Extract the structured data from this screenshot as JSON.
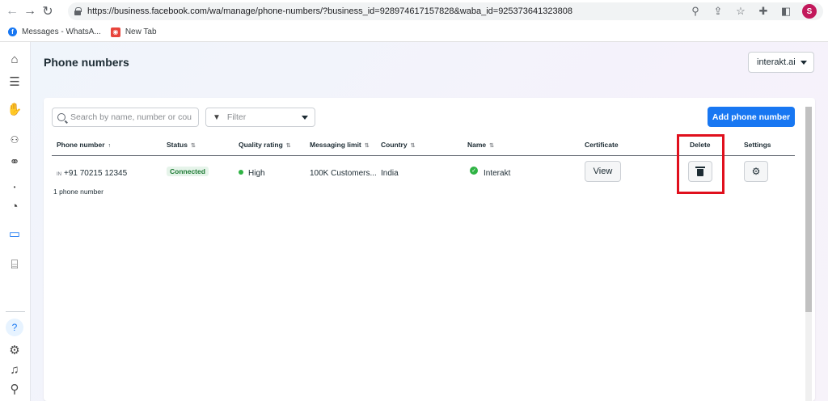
{
  "browser": {
    "url_display": "https://business.facebook.com/wa/manage/phone-numbers/?business_id=928974617157828&waba_id=925373641323808",
    "profile_initial": "S",
    "bookmarks": [
      {
        "label": "Messages - WhatsA..."
      },
      {
        "label": "New Tab"
      }
    ]
  },
  "page": {
    "title": "Phone numbers",
    "business_selector": "interakt.ai"
  },
  "toolbar": {
    "search_placeholder": "Search by name, number or country",
    "filter_label": "Filter",
    "add_button": "Add phone number"
  },
  "table": {
    "columns": [
      {
        "label": "Phone number",
        "sort": "↑"
      },
      {
        "label": "Status",
        "sort": "⇅"
      },
      {
        "label": "Quality rating",
        "sort": "⇅"
      },
      {
        "label": "Messaging limit",
        "sort": "⇅"
      },
      {
        "label": "Country",
        "sort": "⇅"
      },
      {
        "label": "Name",
        "sort": "⇅"
      },
      {
        "label": "Certificate",
        "sort": ""
      },
      {
        "label": "Delete",
        "sort": ""
      },
      {
        "label": "Settings",
        "sort": ""
      }
    ],
    "rows": [
      {
        "country_code": "IN",
        "phone": "+91 70215 12345",
        "status": "Connected",
        "quality": "High",
        "limit": "100K Customers...",
        "country": "India",
        "name": "Interakt",
        "certificate_action": "View"
      }
    ],
    "count_text": "1 phone number"
  },
  "colors": {
    "primary": "#1877f2",
    "status_green": "#2fb344",
    "highlight_red": "#e0101d"
  }
}
